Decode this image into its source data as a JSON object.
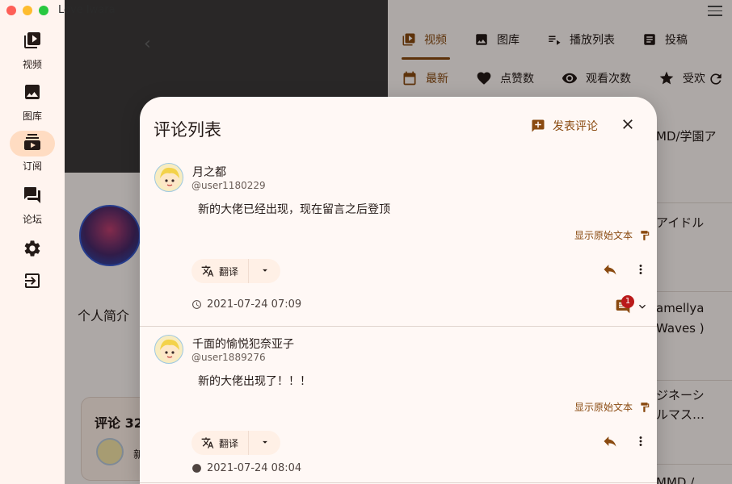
{
  "app": {
    "title": "Love Iwara"
  },
  "rail": [
    {
      "id": "video",
      "label": "视频",
      "icon": "video-library-icon",
      "active": false
    },
    {
      "id": "gallery",
      "label": "图库",
      "icon": "image-icon",
      "active": false
    },
    {
      "id": "subscriptions",
      "label": "订阅",
      "icon": "subscriptions-icon",
      "active": true
    },
    {
      "id": "forum",
      "label": "论坛",
      "icon": "forum-icon",
      "active": false
    },
    {
      "id": "settings",
      "label": "",
      "icon": "gear-icon",
      "active": false
    },
    {
      "id": "logout",
      "label": "",
      "icon": "logout-icon",
      "active": false
    }
  ],
  "profile": {
    "bio_label": "个人简介",
    "comments_title": "评论 32",
    "comment_preview": "新"
  },
  "right_tabs": [
    {
      "label": "视频",
      "icon": "video-library-icon",
      "active": true
    },
    {
      "label": "图库",
      "icon": "image-icon",
      "active": false
    },
    {
      "label": "播放列表",
      "icon": "playlist-icon",
      "active": false
    },
    {
      "label": "投稿",
      "icon": "article-icon",
      "active": false
    }
  ],
  "sort_tabs": [
    {
      "label": "最新",
      "icon": "calendar-icon",
      "active": true
    },
    {
      "label": "点赞数",
      "icon": "heart-icon",
      "active": false
    },
    {
      "label": "观看次数",
      "icon": "eye-icon",
      "active": false
    },
    {
      "label": "受欢",
      "icon": "star-icon",
      "active": false
    }
  ],
  "video_list": [
    {
      "line1": "MD/学園ア",
      "line2": ""
    },
    {
      "line1": "アイドル",
      "line2": ""
    },
    {
      "line1": "amellya",
      "line2": " Waves )"
    },
    {
      "line1": "ジネーシ",
      "line2": "ルマス…"
    },
    {
      "line1": "MMD /",
      "line2": ""
    }
  ],
  "dialog": {
    "title": "评论列表",
    "post_label": "发表评论",
    "comments": [
      {
        "name": "月之都",
        "handle": "@user1180229",
        "body": "新的大佬已经出现，现在留言之后登顶",
        "show_original": "显示原始文本",
        "translate_label": "翻译",
        "time": "2021-07-24 07:09",
        "reply_count": "1"
      },
      {
        "name": "千面的愉悦犯奈亚子",
        "handle": "@user1889276",
        "body": "新的大佬出现了！！！",
        "show_original": "显示原始文本",
        "translate_label": "翻译",
        "time": "2021-07-24 08:04",
        "reply_count": ""
      }
    ]
  },
  "colors": {
    "accent": "#8a4a10",
    "rail_active": "#ffdcc2",
    "badge": "#ba1a1a",
    "dialog_bg": "#fff8f5"
  }
}
